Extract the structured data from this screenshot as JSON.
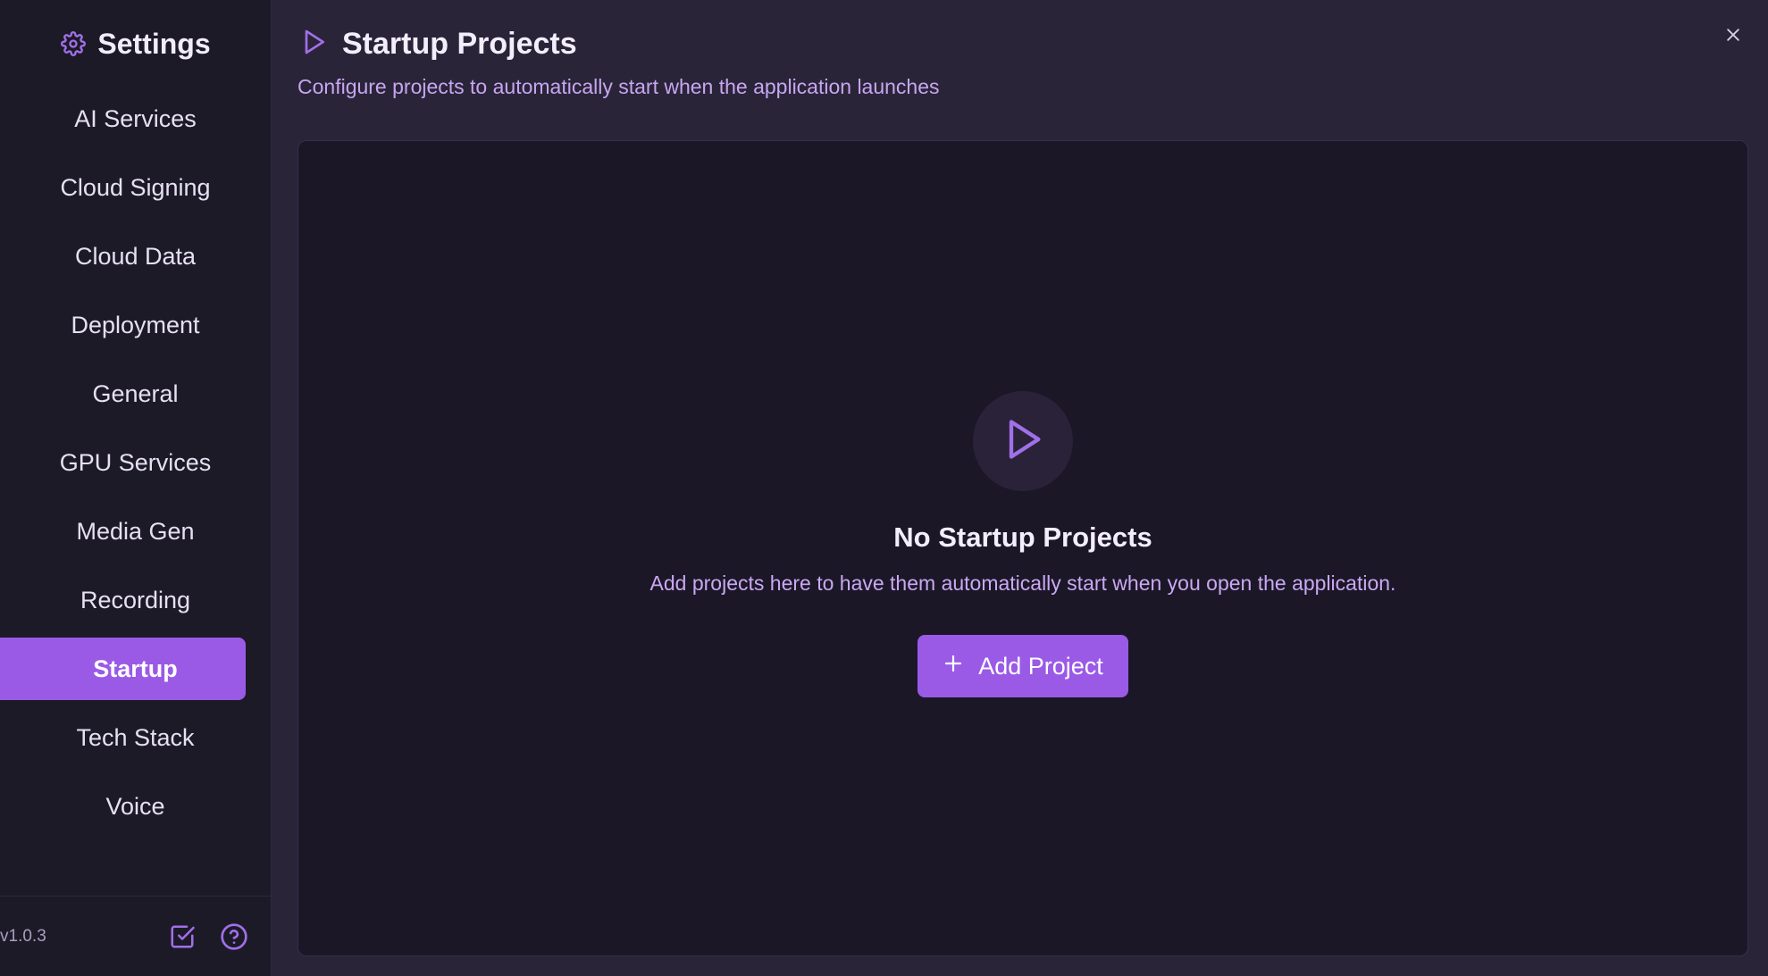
{
  "sidebar": {
    "title": "Settings",
    "items": [
      {
        "label": "AI Services",
        "active": false
      },
      {
        "label": "Cloud Signing",
        "active": false
      },
      {
        "label": "Cloud Data",
        "active": false
      },
      {
        "label": "Deployment",
        "active": false
      },
      {
        "label": "General",
        "active": false
      },
      {
        "label": "GPU Services",
        "active": false
      },
      {
        "label": "Media Gen",
        "active": false
      },
      {
        "label": "Recording",
        "active": false
      },
      {
        "label": "Startup",
        "active": true
      },
      {
        "label": "Tech Stack",
        "active": false
      },
      {
        "label": "Voice",
        "active": false
      }
    ],
    "version": "v1.0.3"
  },
  "main": {
    "title": "Startup Projects",
    "subtitle": "Configure projects to automatically start when the application launches",
    "empty": {
      "title": "No Startup Projects",
      "description": "Add projects here to have them automatically start when you open the application.",
      "button_label": "Add Project"
    }
  },
  "icons": {
    "settings": "gear-icon",
    "page": "play-icon",
    "close": "close-icon",
    "add": "plus-icon",
    "footer_tasks": "checkbox-icon",
    "footer_help": "help-icon"
  },
  "colors": {
    "accent": "#9a5ae6",
    "sidebar_bg": "#1d1a28",
    "main_bg": "#2a2439",
    "panel_bg": "#1b1727"
  }
}
